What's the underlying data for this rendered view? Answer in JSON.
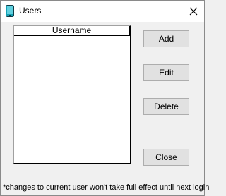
{
  "window": {
    "title": "Users",
    "icon": "user-phone-icon",
    "close_glyph": "✕"
  },
  "list": {
    "column_header": "Username",
    "rows": []
  },
  "buttons": {
    "add": "Add",
    "edit": "Edit",
    "delete": "Delete",
    "close": "Close"
  },
  "footnote": "*changes to current user won't take full effect until next login",
  "colors": {
    "background": "#f0f0f0",
    "button_face": "#e1e1e1",
    "button_border": "#adadad",
    "icon_accent": "#14a0b4"
  }
}
